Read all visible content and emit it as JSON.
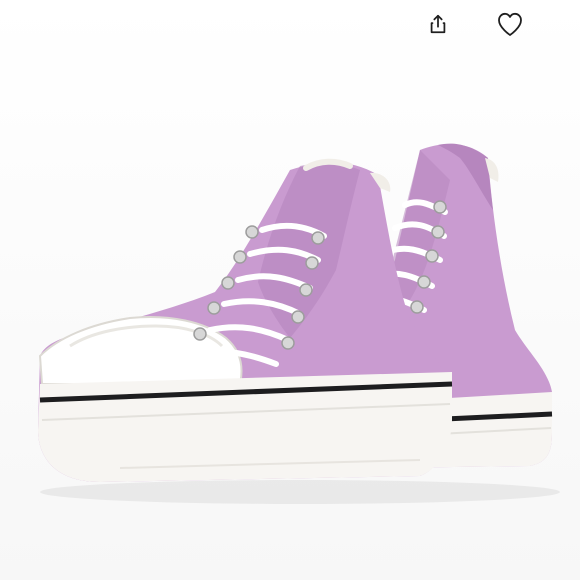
{
  "colors": {
    "canvas": "#ffffff",
    "shoe_canvas": "#c99bd0",
    "shoe_shadow": "#b686be",
    "sole": "#f7f5f2",
    "stripe": "#1d1d1f",
    "toe_cap": "#ffffff",
    "lace": "#ffffff",
    "eyelet": "#c7c7c7",
    "icon": "#1f1f1f"
  },
  "actions": {
    "share_icon": "share-icon",
    "like_icon": "heart-icon"
  },
  "product": {
    "image_icon": "sneaker-image"
  }
}
